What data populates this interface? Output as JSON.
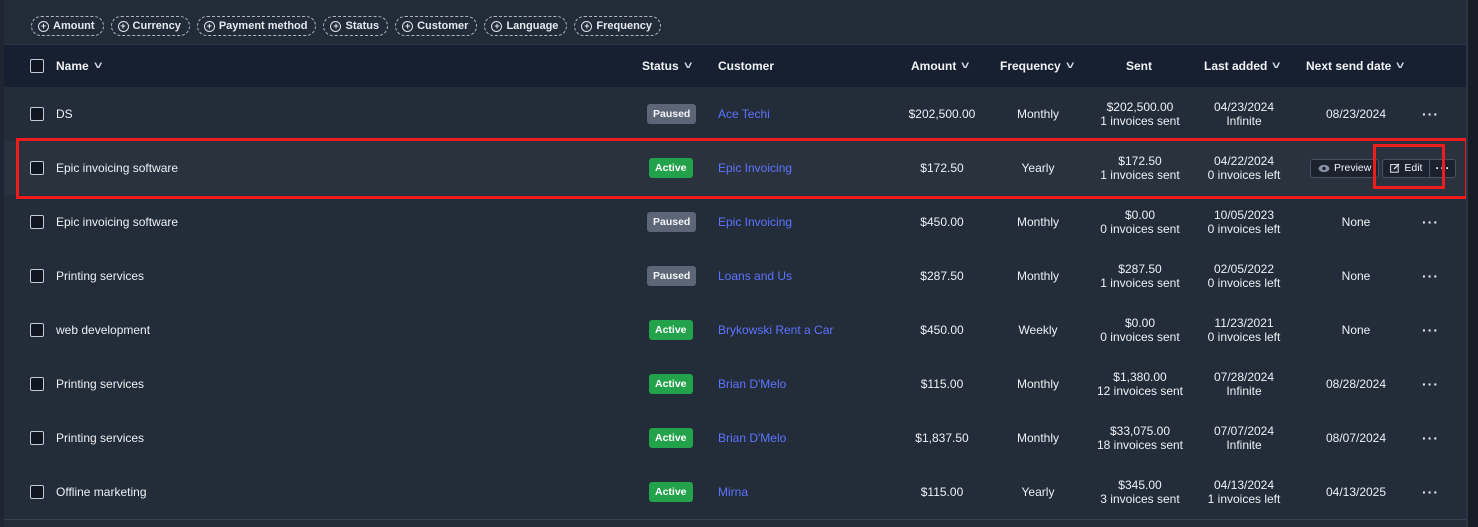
{
  "filters": [
    "Amount",
    "Currency",
    "Payment method",
    "Status",
    "Customer",
    "Language",
    "Frequency"
  ],
  "columns": {
    "name": "Name",
    "status": "Status",
    "customer": "Customer",
    "amount": "Amount",
    "frequency": "Frequency",
    "sent": "Sent",
    "last_added": "Last added",
    "next_send_date": "Next send date"
  },
  "rows": [
    {
      "name": "DS",
      "status": "Paused",
      "customer": "Ace Techi",
      "amount": "$202,500.00",
      "frequency": "Monthly",
      "sent_amount": "$202,500.00",
      "sent_count": "1 invoices sent",
      "last_date": "04/23/2024",
      "last_info": "Infinite",
      "next": "08/23/2024"
    },
    {
      "name": "Epic invoicing software",
      "status": "Active",
      "customer": "Epic Invoicing",
      "amount": "$172.50",
      "frequency": "Yearly",
      "sent_amount": "$172.50",
      "sent_count": "1 invoices sent",
      "last_date": "04/22/2024",
      "last_info": "0 invoices left",
      "next": ""
    },
    {
      "name": "Epic invoicing software",
      "status": "Paused",
      "customer": "Epic Invoicing",
      "amount": "$450.00",
      "frequency": "Monthly",
      "sent_amount": "$0.00",
      "sent_count": "0 invoices sent",
      "last_date": "10/05/2023",
      "last_info": "0 invoices left",
      "next": "None"
    },
    {
      "name": "Printing services",
      "status": "Paused",
      "customer": "Loans and Us",
      "amount": "$287.50",
      "frequency": "Monthly",
      "sent_amount": "$287.50",
      "sent_count": "1 invoices sent",
      "last_date": "02/05/2022",
      "last_info": "0 invoices left",
      "next": "None"
    },
    {
      "name": "web development",
      "status": "Active",
      "customer": "Brykowski Rent a Car",
      "amount": "$450.00",
      "frequency": "Weekly",
      "sent_amount": "$0.00",
      "sent_count": "0 invoices sent",
      "last_date": "11/23/2021",
      "last_info": "0 invoices left",
      "next": "None"
    },
    {
      "name": "Printing services",
      "status": "Active",
      "customer": "Brian D'Melo",
      "amount": "$115.00",
      "frequency": "Monthly",
      "sent_amount": "$1,380.00",
      "sent_count": "12 invoices sent",
      "last_date": "07/28/2024",
      "last_info": "Infinite",
      "next": "08/28/2024"
    },
    {
      "name": "Printing services",
      "status": "Active",
      "customer": "Brian D'Melo",
      "amount": "$1,837.50",
      "frequency": "Monthly",
      "sent_amount": "$33,075.00",
      "sent_count": "18 invoices sent",
      "last_date": "07/07/2024",
      "last_info": "Infinite",
      "next": "08/07/2024"
    },
    {
      "name": "Offline marketing",
      "status": "Active",
      "customer": "Mirna",
      "amount": "$115.00",
      "frequency": "Yearly",
      "sent_amount": "$345.00",
      "sent_count": "3 invoices sent",
      "last_date": "04/13/2024",
      "last_info": "1 invoices left",
      "next": "04/13/2025"
    }
  ],
  "row_actions": {
    "preview": "Preview",
    "edit": "Edit"
  },
  "colors": {
    "accent_link": "#5d74ff",
    "active": "#22a24b",
    "paused": "#5c6676",
    "highlight_box": "#ee1c1c"
  }
}
